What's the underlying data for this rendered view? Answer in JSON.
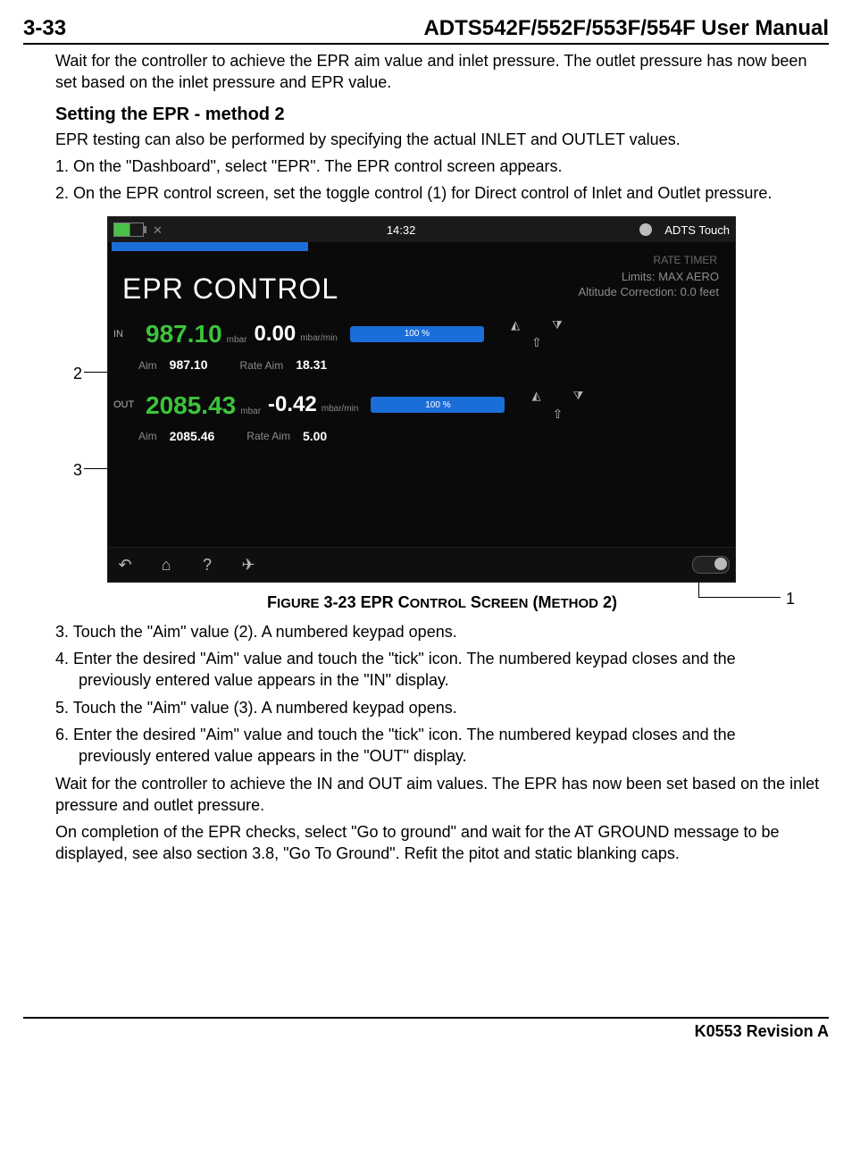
{
  "header": {
    "page_num": "3-33",
    "title": "ADTS542F/552F/553F/554F User Manual"
  },
  "body": {
    "intro": "Wait for the controller to achieve the EPR aim value and inlet pressure. The outlet pressure has now been set based on the inlet pressure and EPR value.",
    "heading": "Setting the EPR - method 2",
    "p_sub": "EPR testing can also be performed by specifying the actual INLET and OUTLET values.",
    "step1": "1. On the \"Dashboard\", select \"EPR\". The EPR control screen appears.",
    "step2": "2. On the EPR control screen, set the toggle control (1) for Direct control of Inlet and Outlet pressure.",
    "fig_caption": "Figure 3-23 EPR Control Screen (Method 2)",
    "step3": "3. Touch the \"Aim\" value (2). A numbered keypad opens.",
    "step4a": "4. Enter the desired \"Aim\" value and touch the \"tick\" icon. The numbered keypad closes and the",
    "step4b": "previously entered value appears in the \"IN\" display.",
    "step5": "5. Touch the \"Aim\" value (3). A numbered keypad opens.",
    "step6a": "6. Enter the desired \"Aim\" value and touch the \"tick\" icon. The numbered keypad closes and the",
    "step6b": "previously entered value appears in the \"OUT\" display.",
    "wait": "Wait for the controller to achieve the IN and OUT aim values. The EPR has now been set based on the inlet pressure and outlet pressure.",
    "completion": "On completion of the EPR checks, select \"Go to ground\" and wait for the AT GROUND message to be displayed, see also section 3.8, \"Go To Ground\". Refit the pitot and static blanking caps."
  },
  "callouts": {
    "c1": "1",
    "c2": "2",
    "c3": "3"
  },
  "screen": {
    "time": "14:32",
    "brand": "ADTS Touch",
    "rate_timer": "RATE TIMER",
    "title": "EPR CONTROL",
    "limits_l1": "Limits: MAX AERO",
    "limits_l2": "Altitude Correction: 0.0 feet",
    "in": {
      "label": "IN",
      "value": "987.10",
      "unit": "mbar",
      "rate": "0.00",
      "rate_unit": "mbar/min",
      "pct": "100 %",
      "aim_label": "Aim",
      "aim": "987.10",
      "rateaim_label": "Rate Aim",
      "rate_aim": "18.31"
    },
    "out": {
      "label": "OUT",
      "value": "2085.43",
      "unit": "mbar",
      "rate": "-0.42",
      "rate_unit": "mbar/min",
      "pct": "100 %",
      "aim_label": "Aim",
      "aim": "2085.46",
      "rateaim_label": "Rate Aim",
      "rate_aim": "5.00"
    }
  },
  "footer": {
    "rev": "K0553 Revision A"
  }
}
